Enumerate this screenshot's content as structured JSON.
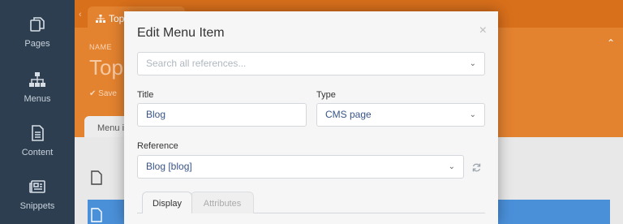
{
  "sidebar": {
    "items": [
      {
        "label": "Pages",
        "icon": "pages-icon"
      },
      {
        "label": "Menus",
        "icon": "sitemap-icon"
      },
      {
        "label": "Content",
        "icon": "file-text-icon"
      },
      {
        "label": "Snippets",
        "icon": "newspaper-icon"
      }
    ]
  },
  "background": {
    "tab_label": "Top",
    "name_label": "NAME",
    "title": "Top",
    "save_label": "Save",
    "subtab_label": "Menu i"
  },
  "modal": {
    "title": "Edit Menu Item",
    "close": "×",
    "search_placeholder": "Search all references...",
    "title_label": "Title",
    "title_value": "Blog",
    "type_label": "Type",
    "type_value": "CMS page",
    "reference_label": "Reference",
    "reference_value": "Blog [blog]",
    "tabs": [
      "Display",
      "Attributes"
    ]
  },
  "colors": {
    "sidebar": "#2d3e50",
    "orange": "#e3822f",
    "orange_dark": "#d86f1b",
    "selected_row": "#4a90d9"
  }
}
